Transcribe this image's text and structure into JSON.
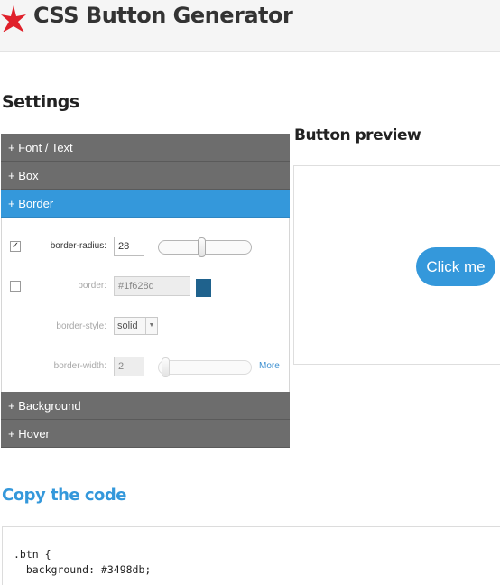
{
  "header": {
    "title": "CSS Button Generator"
  },
  "settings": {
    "title": "Settings",
    "sections": {
      "font_text": "+ Font / Text",
      "box": "+ Box",
      "border": "+ Border",
      "background": "+ Background",
      "hover": "+ Hover"
    },
    "border": {
      "radius": {
        "checked": true,
        "check_glyph": "✓",
        "label": "border-radius:",
        "value": "28"
      },
      "border": {
        "checked": false,
        "label": "border:",
        "value": "#1f628d",
        "swatch_color": "#1f628d"
      },
      "style": {
        "label": "border-style:",
        "value": "solid",
        "arrow": "▼"
      },
      "width": {
        "label": "border-width:",
        "value": "2",
        "more_link": "More"
      }
    }
  },
  "preview": {
    "title": "Button preview",
    "button_label": "Click me",
    "button_color": "#3498db"
  },
  "code": {
    "title": "Copy the code",
    "line1": ".btn {",
    "line2": "  background: #3498db;"
  },
  "colors": {
    "accent": "#3498db",
    "section_header": "#6d6d6d",
    "logo": "#e0202a"
  }
}
